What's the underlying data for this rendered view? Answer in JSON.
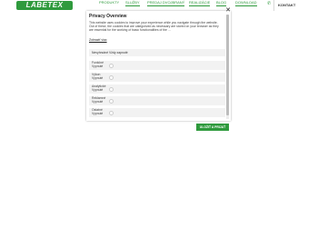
{
  "header": {
    "logo": "LABETEX",
    "nav": [
      "PRODUKTY",
      "SLUŽBY",
      "PREDAJ DVOJBRANÝ",
      "REALIZÁCIE",
      "BLOG",
      "DOWNLOAD"
    ],
    "contact": "KONTAKT"
  },
  "modal": {
    "title": "Privacy Overview",
    "description": "This website uses cookies to improve your experience while you navigate through the website. Out of these, the cookies that are categorized as necessary are stored on your browser as they are essential for the working of basic functionalities of the ...",
    "link": "Zobraziť viac",
    "necessary_label": "Nevyhnutné Vždy zapnuté",
    "categories": [
      {
        "name": "Funkčné",
        "state": "Vypnuté"
      },
      {
        "name": "Výkon",
        "state": "Vypnuté"
      },
      {
        "name": "Analytické",
        "state": "Vypnuté"
      },
      {
        "name": "Reklamné",
        "state": "Vypnuté"
      },
      {
        "name": "Ostatné",
        "state": "Vypnuté"
      }
    ],
    "accept": "ULOŽIŤ A PRIJAŤ"
  },
  "colors": {
    "brand": "#2f9a3d"
  }
}
